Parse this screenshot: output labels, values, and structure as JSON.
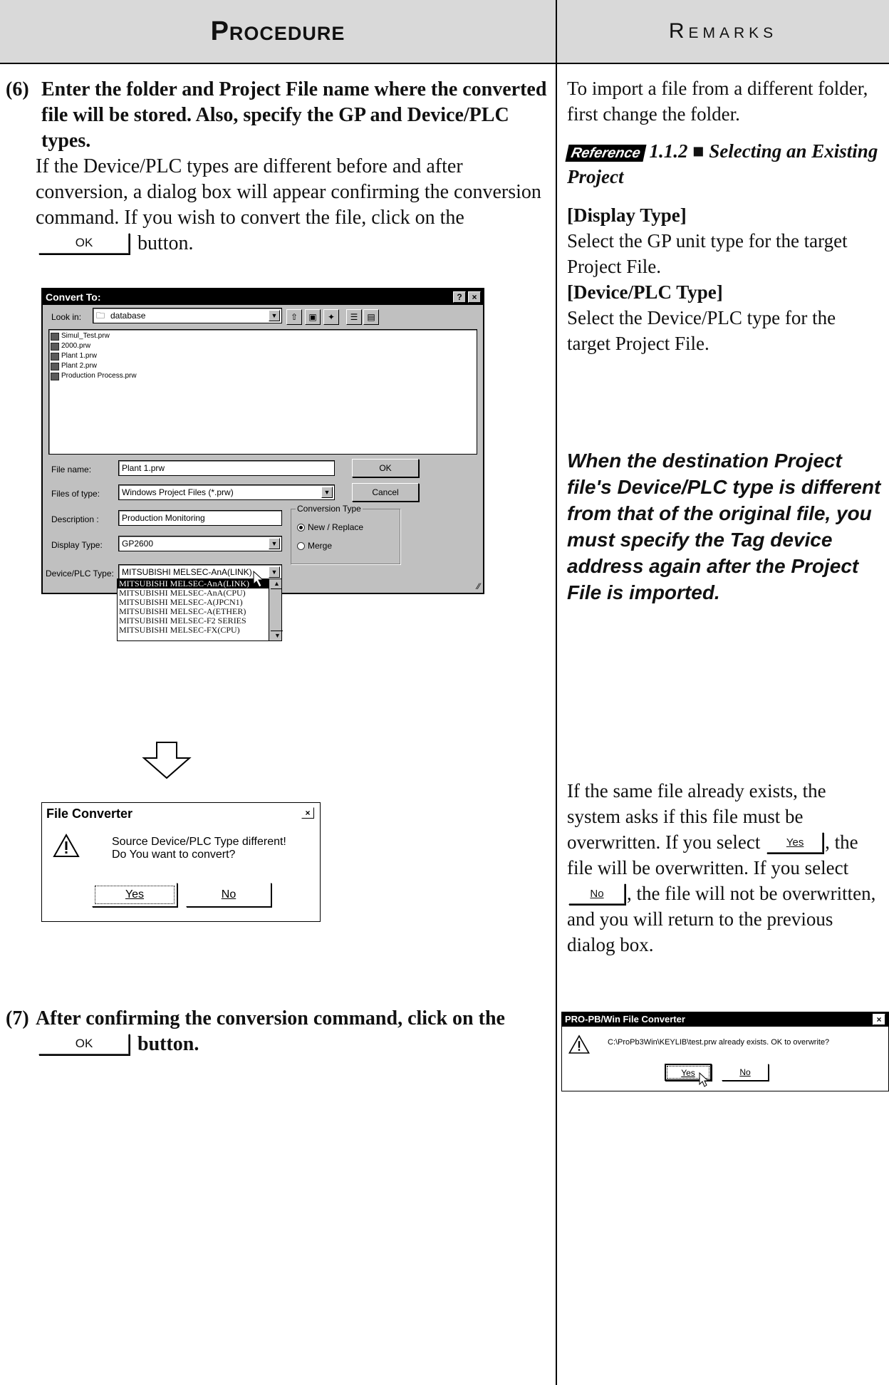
{
  "header": {
    "procedure": "Procedure",
    "remarks": "Remarks"
  },
  "step6": {
    "number": "(6)",
    "bold_text": "Enter the folder and Project File name where the converted file will be stored. Also, specify the GP and Device/PLC types.",
    "body_before": "If the Device/PLC types are different before and after conversion, a dialog box will appear confirming the conversion command. If you wish to convert the file, click on the",
    "ok_button": "OK",
    "body_after": "button."
  },
  "convert_dialog": {
    "title": "Convert To:",
    "help": "?",
    "close": "×",
    "look_in_label": "Look in:",
    "look_in_value": "database",
    "files": [
      "Simul_Test.prw",
      "2000.prw",
      "Plant 1.prw",
      "Plant 2.prw",
      "Production Process.prw"
    ],
    "file_name_label": "File name:",
    "file_name_value": "Plant 1.prw",
    "files_of_type_label": "Files of type:",
    "files_of_type_value": "Windows Project Files (*.prw)",
    "description_label": "Description :",
    "description_value": "Production Monitoring",
    "display_type_label": "Display Type:",
    "display_type_value": "GP2600",
    "device_plc_label": "Device/PLC Type:",
    "device_plc_value": "MITSUBISHI MELSEC-AnA(LINK)",
    "ok": "OK",
    "cancel": "Cancel",
    "conversion_type_label": "Conversion Type",
    "new_replace": "New / Replace",
    "merge": "Merge",
    "dropdown_options": [
      "MITSUBISHI MELSEC-AnA(LINK)",
      "MITSUBISHI MELSEC-AnA(CPU)",
      "MITSUBISHI MELSEC-A(JPCN1)",
      "MITSUBISHI MELSEC-A(ETHER)",
      "MITSUBISHI MELSEC-F2 SERIES",
      "MITSUBISHI MELSEC-FX(CPU)"
    ]
  },
  "converter_dialog": {
    "title": "File Converter",
    "close": "×",
    "message_line1": "Source Device/PLC Type different!",
    "message_line2": "Do You want to convert?",
    "yes": "Yes",
    "no": "No"
  },
  "step7": {
    "number": "(7)",
    "text_before": "After confirming the conversion command, click on the",
    "ok_button": "OK",
    "text_after": "button."
  },
  "remarks": {
    "import_note": "To import a file from a different folder, first change the folder.",
    "reference_label": "Reference",
    "reference_text": "1.1.2 ■ Selecting an Existing Project",
    "display_type_heading": "[Display Type]",
    "display_type_text": "Select the GP unit type for the target Project File.",
    "device_type_heading": "[Device/PLC Type]",
    "device_type_text": "Select the Device/PLC type for the target Project File.",
    "warning": "When the destination Project file's Device/PLC type is different from that of the original file, you must specify the Tag device address again after the Project File is imported.",
    "overwrite_1": "If the same file already exists, the system asks if this file must be overwritten. If you select",
    "yes_button": "Yes",
    "overwrite_2": ", the file will be overwritten. If you select",
    "no_button": "No",
    "overwrite_3": ", the file will not be overwritten, and you will return to the previous dialog box."
  },
  "overwrite_dialog": {
    "title": "PRO-PB/Win File Converter",
    "close": "×",
    "message": "C:\\ProPb3Win\\KEYLIB\\test.prw already exists. OK to overwrite?",
    "yes": "Yes",
    "no": "No"
  }
}
